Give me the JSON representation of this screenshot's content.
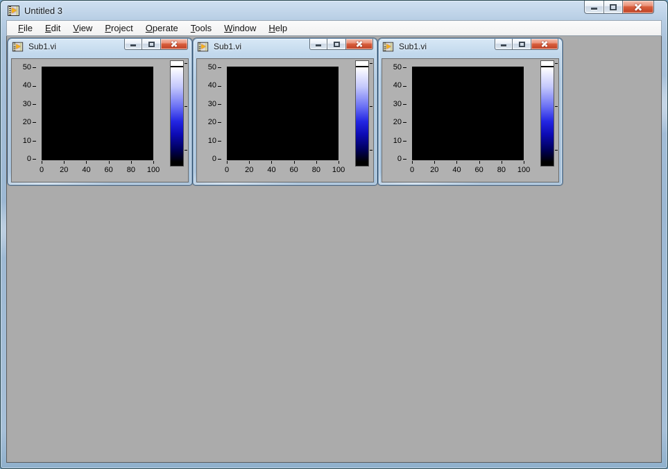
{
  "window": {
    "title": "Untitled 3",
    "icon": "labview-vi-icon"
  },
  "caption_buttons": {
    "minimize": "Minimize",
    "maximize": "Maximize",
    "close": "Close"
  },
  "menu": {
    "items": [
      {
        "label": "File",
        "u": 0
      },
      {
        "label": "Edit",
        "u": 0
      },
      {
        "label": "View",
        "u": 0
      },
      {
        "label": "Project",
        "u": 0
      },
      {
        "label": "Operate",
        "u": 0
      },
      {
        "label": "Tools",
        "u": 0
      },
      {
        "label": "Window",
        "u": 0
      },
      {
        "label": "Help",
        "u": 0
      }
    ]
  },
  "colors": {
    "client_background": "#ababab",
    "panel_background": "#b1b1b1",
    "plot_background": "#000000",
    "titlebar_glass": "#b9cfe5",
    "close_button_red": "#d9603e",
    "ramp_blue": "#2326e2"
  },
  "subwindows": [
    {
      "title": "Sub1.vi"
    },
    {
      "title": "Sub1.vi"
    },
    {
      "title": "Sub1.vi"
    }
  ],
  "chart_data": {
    "type": "heatmap",
    "title": "",
    "xlabel": "",
    "ylabel": "",
    "x_range": [
      0,
      100
    ],
    "y_range": [
      0,
      50
    ],
    "x_tick_labels": [
      "0",
      "20",
      "40",
      "60",
      "80",
      "100"
    ],
    "y_tick_labels": [
      "50",
      "40",
      "30",
      "20",
      "10",
      "0"
    ],
    "values": "uniform zero (entire intensity plot rendered black, no data displayed)",
    "colorbar": {
      "top_color": "#ffffff",
      "mid_color": "#2326e2",
      "bottom_color": "#000000"
    }
  }
}
